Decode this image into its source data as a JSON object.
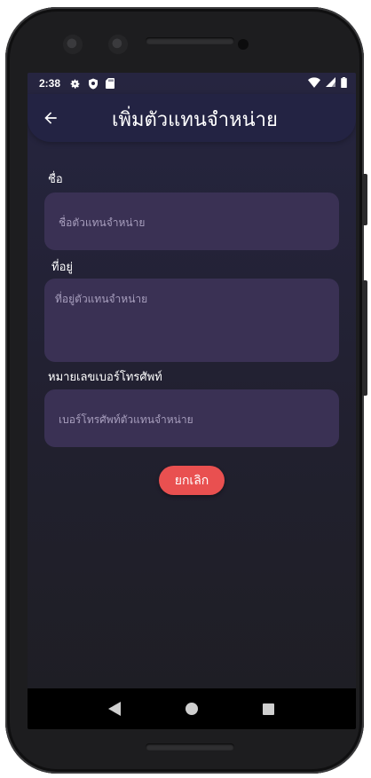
{
  "status_bar": {
    "time": "2:38",
    "left_icons": [
      "settings-icon",
      "shield-icon",
      "sd-card-icon"
    ],
    "right_icons": [
      "wifi-icon",
      "signal-icon",
      "battery-icon"
    ]
  },
  "app_bar": {
    "back_icon": "arrow-left-icon",
    "title": "เพิ่มตัวแทนจำหน่าย"
  },
  "form": {
    "name": {
      "label": "ชื่อ",
      "placeholder": "ชื่อตัวแทนจำหน่าย"
    },
    "address": {
      "label": "ที่อยู่",
      "placeholder": "ที่อยู่ตัวแทนจำหน่าย"
    },
    "phone": {
      "label": "หมายเลขเบอร์โทรศัพท์",
      "placeholder": "เบอร์โทรศัพท์ตัวแทนจำหน่าย"
    }
  },
  "actions": {
    "cancel_label": "ยกเลิก"
  },
  "colors": {
    "app_bar": "#232343",
    "field_bg": "#3a3154",
    "placeholder": "#a89fbe",
    "cancel_button": "#e95050"
  },
  "nav_bar": {
    "icons": [
      "back-triangle-icon",
      "home-circle-icon",
      "recents-square-icon"
    ]
  }
}
